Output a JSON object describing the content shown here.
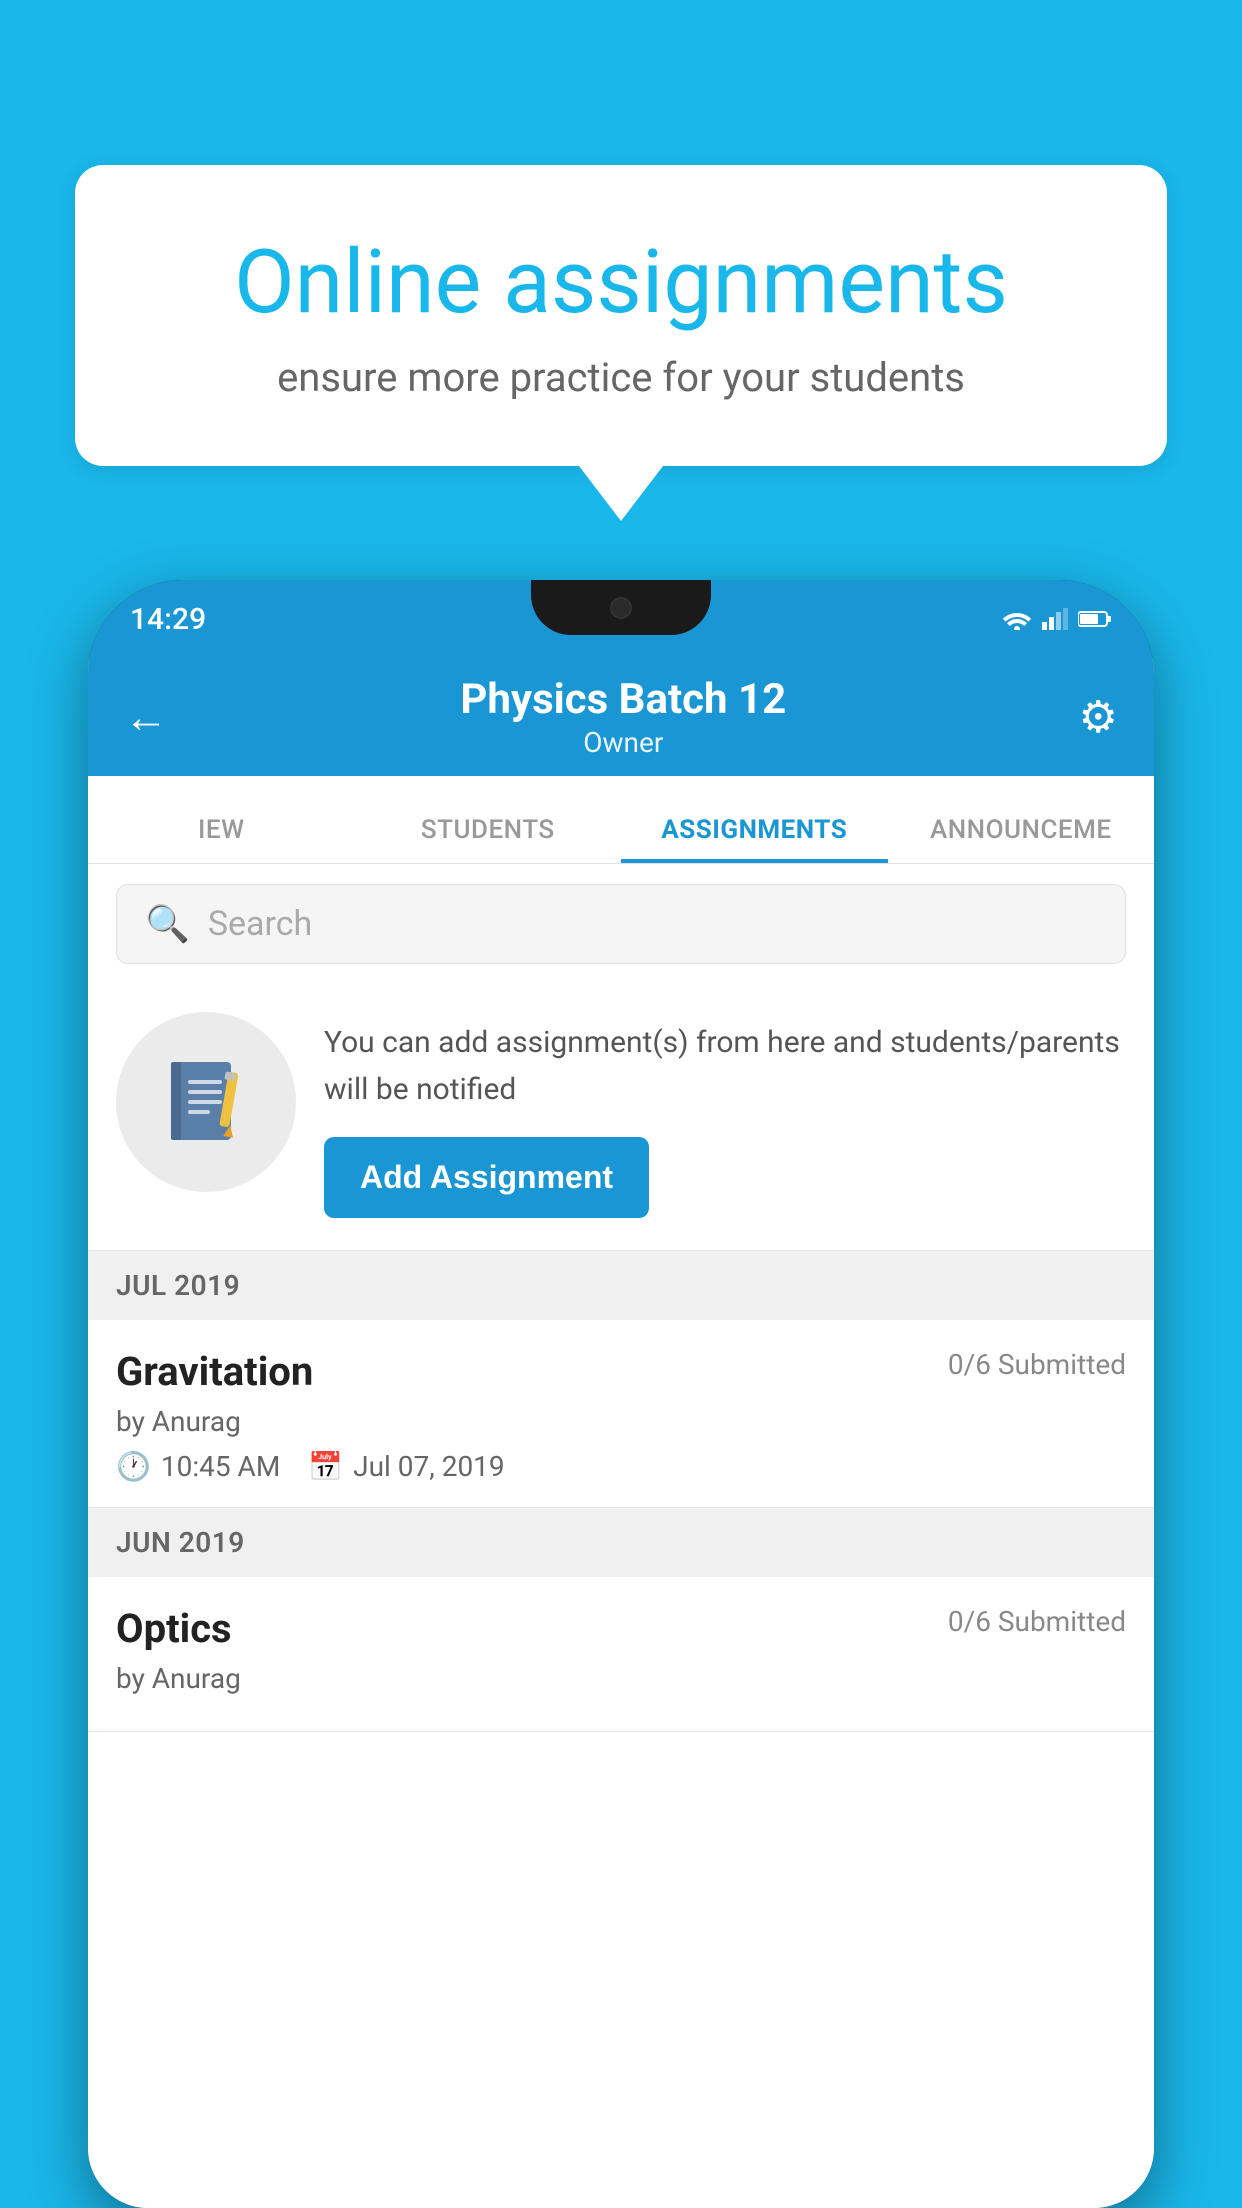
{
  "background_color": "#1ab7ea",
  "speech_bubble": {
    "title": "Online assignments",
    "subtitle": "ensure more practice for your students"
  },
  "status_bar": {
    "time": "14:29"
  },
  "header": {
    "title": "Physics Batch 12",
    "subtitle": "Owner",
    "back_label": "←",
    "settings_label": "⚙"
  },
  "tabs": [
    {
      "id": "iew",
      "label": "IEW",
      "active": false
    },
    {
      "id": "students",
      "label": "STUDENTS",
      "active": false
    },
    {
      "id": "assignments",
      "label": "ASSIGNMENTS",
      "active": true
    },
    {
      "id": "announcements",
      "label": "ANNOUNCEME",
      "active": false
    }
  ],
  "search": {
    "placeholder": "Search"
  },
  "promo": {
    "description": "You can add assignment(s) from here and students/parents will be notified",
    "button_label": "Add Assignment"
  },
  "sections": [
    {
      "label": "JUL 2019",
      "assignments": [
        {
          "title": "Gravitation",
          "submitted": "0/6 Submitted",
          "author": "by Anurag",
          "time": "10:45 AM",
          "date": "Jul 07, 2019"
        }
      ]
    },
    {
      "label": "JUN 2019",
      "assignments": [
        {
          "title": "Optics",
          "submitted": "0/6 Submitted",
          "author": "by Anurag",
          "time": "",
          "date": ""
        }
      ]
    }
  ]
}
